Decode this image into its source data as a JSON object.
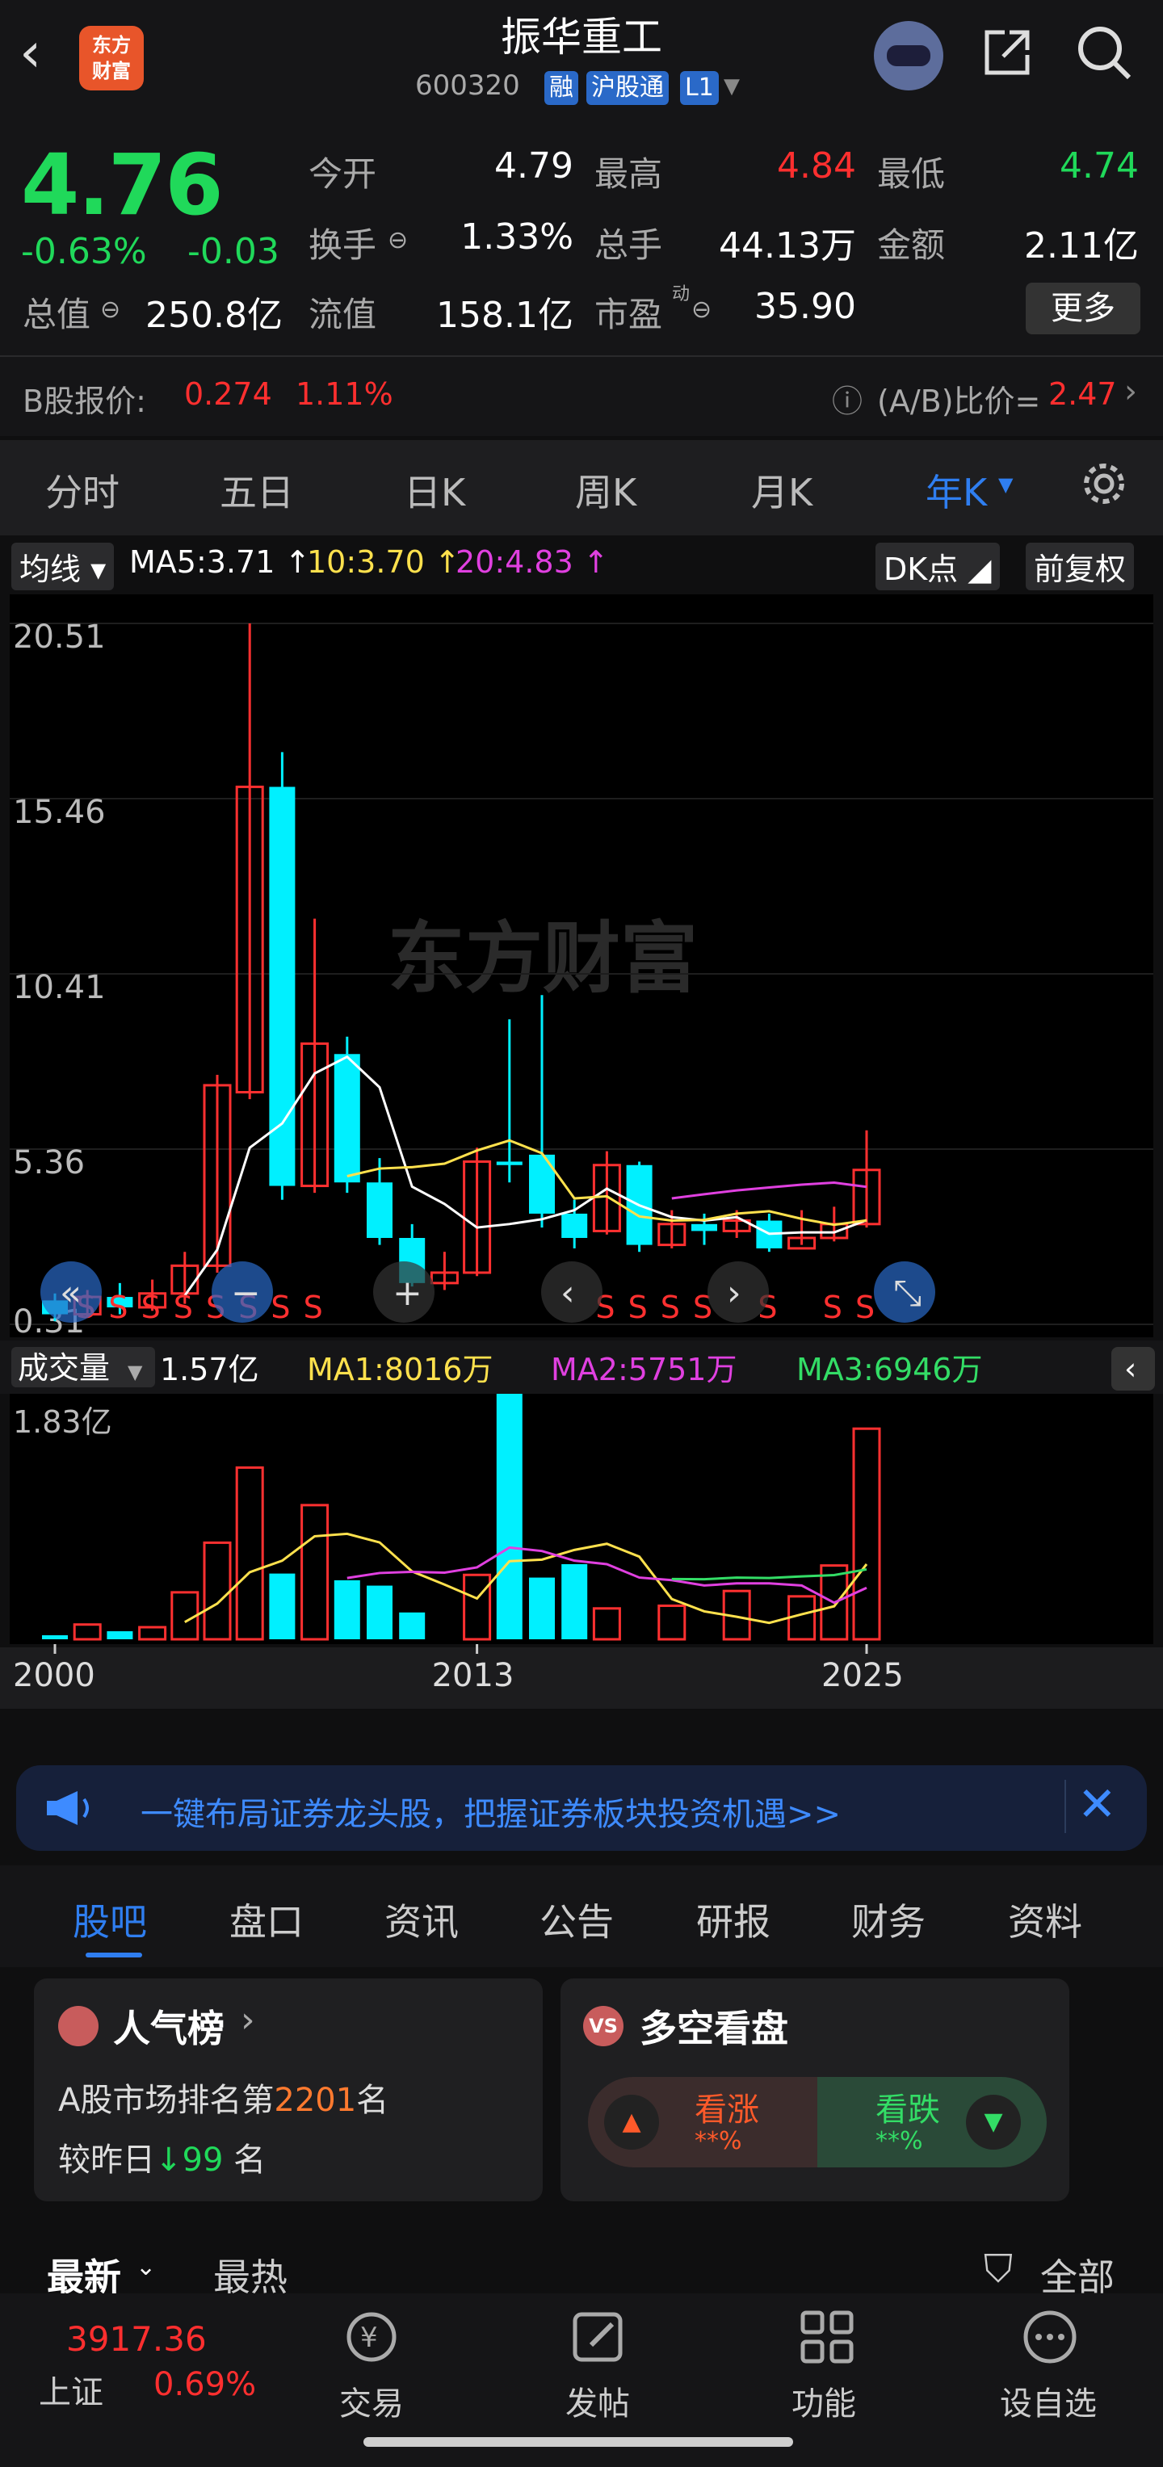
{
  "header": {
    "title": "振华重工",
    "code": "600320",
    "badges": [
      "融",
      "沪股通",
      "L1"
    ],
    "logo_text": "东方\n财富"
  },
  "quote": {
    "price": "4.76",
    "change_pct": "-0.63%",
    "change": "-0.03",
    "open_label": "今开",
    "open": "4.79",
    "high_label": "最高",
    "high": "4.84",
    "low_label": "最低",
    "low": "4.74",
    "turnover_label": "换手",
    "turnover": "1.33%",
    "volume_label": "总手",
    "volume": "44.13万",
    "amount_label": "金额",
    "amount": "2.11亿",
    "mktcap_label": "总值",
    "mktcap": "250.8亿",
    "float_label": "流值",
    "float": "158.1亿",
    "pe_label": "市盈",
    "pe_sup": "动",
    "pe": "35.90",
    "more": "更多"
  },
  "bshare": {
    "label": "B股报价:",
    "price": "0.274",
    "pct": "1.11%",
    "ratio_label": "(A/B)比价=",
    "ratio": "2.47"
  },
  "tabs": [
    "分时",
    "五日",
    "日K",
    "周K",
    "月K",
    "年K"
  ],
  "ma": {
    "label": "均线",
    "ma5": "MA5:3.71",
    "ma10": "10:3.70",
    "ma20": "20:4.83",
    "dk": "DK点",
    "adj": "前复权"
  },
  "yaxis": [
    "20.51",
    "15.46",
    "10.41",
    "5.36",
    "0.31"
  ],
  "volume_panel": {
    "label": "成交量",
    "vol": "1.57亿",
    "ma1": "MA1:8016万",
    "ma2": "MA2:5751万",
    "ma3": "MA3:6946万",
    "ymax": "1.83亿"
  },
  "xaxis": [
    "2000",
    "2013",
    "2025"
  ],
  "watermark": "东方财富",
  "chart_data": {
    "type": "candlestick",
    "years": [
      2000,
      2001,
      2002,
      2003,
      2004,
      2005,
      2006,
      2007,
      2008,
      2009,
      2010,
      2011,
      2012,
      2013,
      2014,
      2015,
      2016,
      2017,
      2018,
      2019,
      2020,
      2021,
      2022,
      2023,
      2024,
      2025
    ],
    "candles": [
      [
        1.0,
        0.6,
        1.2,
        0.4
      ],
      [
        0.6,
        1.1,
        1.3,
        0.5
      ],
      [
        1.1,
        0.8,
        1.5,
        0.6
      ],
      [
        0.8,
        1.2,
        1.6,
        0.7
      ],
      [
        1.2,
        2.0,
        2.4,
        0.9
      ],
      [
        2.0,
        7.2,
        7.5,
        1.8
      ],
      [
        7.0,
        15.8,
        20.51,
        6.8
      ],
      [
        15.8,
        4.3,
        16.8,
        3.9
      ],
      [
        4.3,
        8.4,
        12.0,
        4.1
      ],
      [
        8.1,
        4.4,
        8.6,
        4.1
      ],
      [
        4.4,
        2.8,
        5.1,
        2.6
      ],
      [
        2.8,
        1.5,
        3.2,
        1.4
      ],
      [
        1.5,
        1.8,
        2.4,
        1.3
      ],
      [
        1.8,
        5.0,
        5.4,
        1.7
      ],
      [
        5.0,
        4.9,
        9.1,
        4.4
      ],
      [
        5.2,
        3.5,
        9.8,
        3.1
      ],
      [
        3.5,
        2.8,
        3.9,
        2.5
      ],
      [
        3.0,
        4.9,
        5.3,
        2.9
      ],
      [
        4.9,
        2.6,
        5.0,
        2.4
      ],
      [
        2.6,
        3.2,
        3.6,
        2.5
      ],
      [
        3.2,
        3.0,
        3.5,
        2.6
      ],
      [
        3.0,
        3.3,
        3.6,
        2.8
      ],
      [
        3.3,
        2.5,
        3.5,
        2.4
      ],
      [
        2.5,
        2.8,
        3.6,
        2.6
      ],
      [
        2.8,
        3.2,
        3.7,
        2.7
      ],
      [
        3.2,
        4.76,
        5.9,
        3.1
      ]
    ],
    "volumes": [
      0.03,
      0.11,
      0.06,
      0.09,
      0.35,
      0.72,
      1.28,
      0.49,
      1.0,
      0.44,
      0.4,
      0.2,
      0.0,
      0.48,
      1.83,
      0.46,
      0.56,
      0.23,
      0.0,
      0.25,
      0.0,
      0.36,
      0.0,
      0.32,
      0.55,
      1.57
    ],
    "ylim": [
      0.31,
      20.51
    ],
    "vol_ylim": [
      0,
      1.83
    ]
  },
  "banner": "一键布局证券龙头股，把握证券板块投资机遇>>",
  "bottom_tabs": [
    "股吧",
    "盘口",
    "资讯",
    "公告",
    "研报",
    "财务",
    "资料"
  ],
  "cards": {
    "hot_title": "人气榜",
    "hot_line1_pre": "A股市场排名第",
    "hot_rank": "2201",
    "hot_line1_post": "名",
    "hot_line2_pre": "较昨日",
    "hot_delta": "99",
    "hot_line2_post": "名",
    "ls_title": "多空看盘",
    "bull": "看涨",
    "bull_pct": "**%",
    "bear": "看跌",
    "bear_pct": "**%"
  },
  "sort": {
    "latest": "最新",
    "hot": "最热",
    "all": "全部"
  },
  "nav": {
    "index_val": "3917.36",
    "index_name": "上证",
    "index_pct": "0.69%",
    "trade": "交易",
    "post": "发帖",
    "func": "功能",
    "watch": "设自选"
  }
}
